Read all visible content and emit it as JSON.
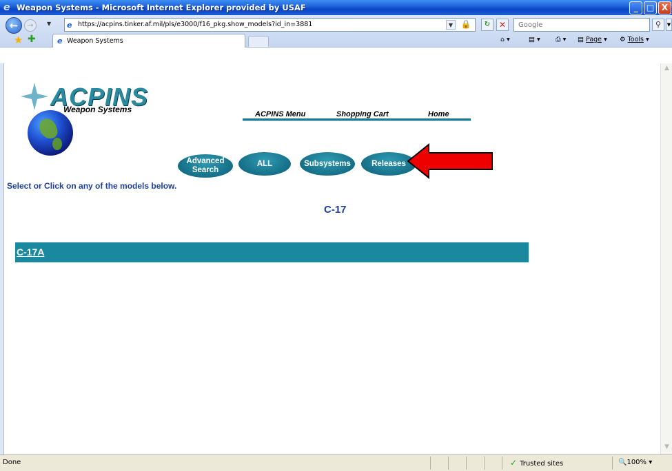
{
  "window": {
    "title": "Weapon Systems - Microsoft Internet Explorer provided by USAF",
    "minimize": "_",
    "maximize": "□",
    "close": "X"
  },
  "addressbar": {
    "url": "https://acpins.tinker.af.mil/pls/e3000/f16_pkg.show_models?id_in=3881",
    "search_placeholder": "Google"
  },
  "tabs": [
    {
      "label": "Weapon Systems"
    }
  ],
  "toolbar": {
    "page_label": "Page",
    "tools_label": "Tools"
  },
  "site": {
    "logo_text": "ACPINS",
    "logo_subtext": "Weapon Systems",
    "menu": [
      "ACPINS Menu",
      "Shopping Cart",
      "Home"
    ],
    "buttons": {
      "advanced_search": "Advanced Search",
      "all": "ALL",
      "subsystems": "Subsystems",
      "releases": "Releases"
    },
    "instruction": "Select or Click on any of the models below.",
    "heading": "C-17",
    "models": [
      "C-17A"
    ],
    "accent_color": "#1a889f",
    "arrow_color": "#ee0000"
  },
  "status": {
    "text": "Done",
    "zone": "Trusted sites",
    "zoom": "100%"
  },
  "icons": [
    "ie-logo-icon",
    "back-arrow-icon",
    "forward-arrow-icon",
    "lock-icon",
    "refresh-icon",
    "stop-icon",
    "search-icon",
    "favorites-star-icon",
    "add-favorites-icon",
    "home-icon",
    "feeds-icon",
    "print-icon",
    "page-icon",
    "tools-gear-icon",
    "globe-logo-icon",
    "red-arrow-icon",
    "trusted-check-icon",
    "zoom-icon"
  ]
}
